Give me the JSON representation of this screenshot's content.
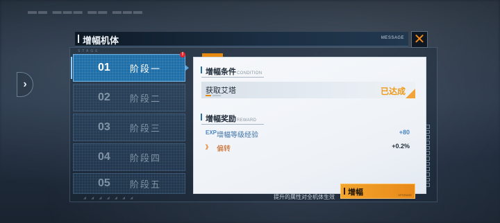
{
  "window": {
    "title": "增幅机体",
    "message_label": "MESSAGE"
  },
  "stage_tag": "STAGE",
  "stages": [
    {
      "num": "01",
      "label": "阶段一"
    },
    {
      "num": "02",
      "label": "阶段二"
    },
    {
      "num": "03",
      "label": "阶段三"
    },
    {
      "num": "04",
      "label": "阶段四"
    },
    {
      "num": "05",
      "label": "阶段五"
    }
  ],
  "alert_badge": "!",
  "condition": {
    "title": "增幅条件",
    "title_en": "CONDITION",
    "item": "获取艾塔",
    "status": "已达成"
  },
  "reward": {
    "title": "增幅奖励",
    "title_en": "REWARD",
    "items": [
      {
        "icon": "EXP",
        "name": "增幅等级经验",
        "value": "+80"
      },
      {
        "icon": "》",
        "name": "偏转",
        "value": "+0.2%"
      }
    ]
  },
  "footnote": "提升的属性对全机体生效",
  "amplify_button": {
    "label": "增幅",
    "sub": "UPGRADE"
  },
  "colors": {
    "accent_orange": "#e8891a",
    "active_tab": "#1e6fa8",
    "exp_blue": "#4a86c4",
    "deflect_orange": "#e87a1a"
  }
}
